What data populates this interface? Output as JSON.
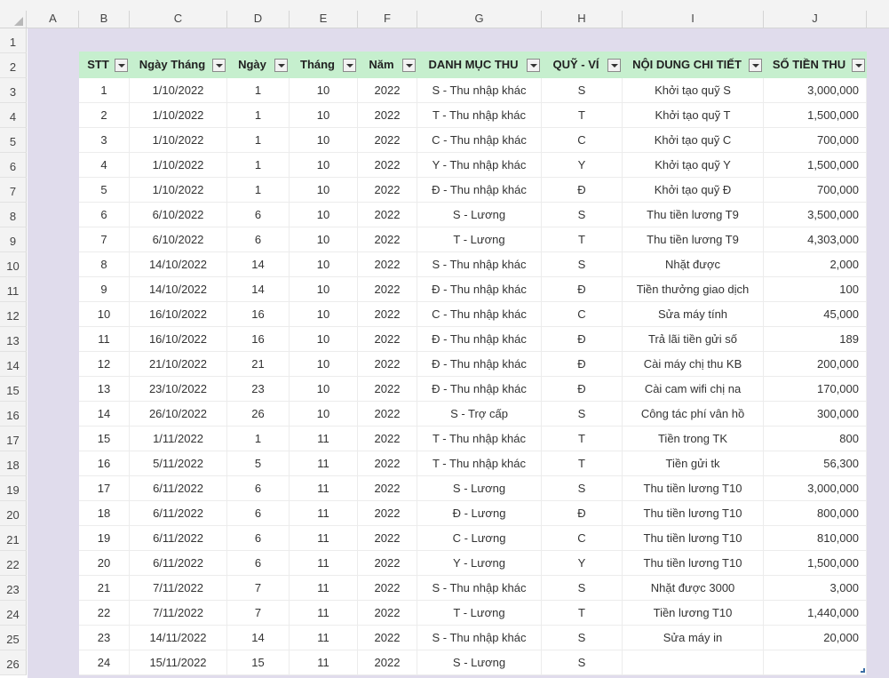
{
  "column_headers": [
    "A",
    "B",
    "C",
    "D",
    "E",
    "F",
    "G",
    "H",
    "I",
    "J"
  ],
  "row_headers": [
    "1",
    "2",
    "3",
    "4",
    "5",
    "6",
    "7",
    "8",
    "9",
    "10",
    "11",
    "12",
    "13",
    "14",
    "15",
    "16",
    "17",
    "18",
    "19",
    "20",
    "21",
    "22",
    "23",
    "24",
    "25",
    "26"
  ],
  "table": {
    "headers": [
      "STT",
      "Ngày Tháng",
      "Ngày",
      "Tháng",
      "Năm",
      "DANH MỤC THU",
      "QUỸ - VÍ",
      "NỘI DUNG CHI TIẾT",
      "SỐ TIỀN THU"
    ],
    "header_color": "#c6efce",
    "rows": [
      [
        "1",
        "1/10/2022",
        "1",
        "10",
        "2022",
        "S - Thu nhập khác",
        "S",
        "Khởi tạo quỹ S",
        "3,000,000"
      ],
      [
        "2",
        "1/10/2022",
        "1",
        "10",
        "2022",
        "T - Thu nhập khác",
        "T",
        "Khởi tạo quỹ T",
        "1,500,000"
      ],
      [
        "3",
        "1/10/2022",
        "1",
        "10",
        "2022",
        "C - Thu nhập khác",
        "C",
        "Khởi tạo quỹ C",
        "700,000"
      ],
      [
        "4",
        "1/10/2022",
        "1",
        "10",
        "2022",
        "Y - Thu nhập khác",
        "Y",
        "Khởi tạo quỹ Y",
        "1,500,000"
      ],
      [
        "5",
        "1/10/2022",
        "1",
        "10",
        "2022",
        "Đ - Thu nhập khác",
        "Đ",
        "Khởi tạo quỹ Đ",
        "700,000"
      ],
      [
        "6",
        "6/10/2022",
        "6",
        "10",
        "2022",
        "S - Lương",
        "S",
        "Thu tiền lương T9",
        "3,500,000"
      ],
      [
        "7",
        "6/10/2022",
        "6",
        "10",
        "2022",
        "T - Lương",
        "T",
        "Thu tiền lương T9",
        "4,303,000"
      ],
      [
        "8",
        "14/10/2022",
        "14",
        "10",
        "2022",
        "S - Thu nhập khác",
        "S",
        "Nhặt được",
        "2,000"
      ],
      [
        "9",
        "14/10/2022",
        "14",
        "10",
        "2022",
        "Đ - Thu nhập khác",
        "Đ",
        "Tiền thưởng giao dịch",
        "100"
      ],
      [
        "10",
        "16/10/2022",
        "16",
        "10",
        "2022",
        "C - Thu nhập khác",
        "C",
        "Sửa máy tính",
        "45,000"
      ],
      [
        "11",
        "16/10/2022",
        "16",
        "10",
        "2022",
        "Đ - Thu nhập khác",
        "Đ",
        "Trả lãi tiền gửi số",
        "189"
      ],
      [
        "12",
        "21/10/2022",
        "21",
        "10",
        "2022",
        "Đ - Thu nhập khác",
        "Đ",
        "Cài máy chị thu KB",
        "200,000"
      ],
      [
        "13",
        "23/10/2022",
        "23",
        "10",
        "2022",
        "Đ - Thu nhập khác",
        "Đ",
        "Cài cam wifi chị na",
        "170,000"
      ],
      [
        "14",
        "26/10/2022",
        "26",
        "10",
        "2022",
        "S - Trợ cấp",
        "S",
        "Công tác phí vân hồ",
        "300,000"
      ],
      [
        "15",
        "1/11/2022",
        "1",
        "11",
        "2022",
        "T - Thu nhập khác",
        "T",
        "Tiền trong TK",
        "800"
      ],
      [
        "16",
        "5/11/2022",
        "5",
        "11",
        "2022",
        "T - Thu nhập khác",
        "T",
        "Tiền gửi tk",
        "56,300"
      ],
      [
        "17",
        "6/11/2022",
        "6",
        "11",
        "2022",
        "S - Lương",
        "S",
        "Thu tiền lương T10",
        "3,000,000"
      ],
      [
        "18",
        "6/11/2022",
        "6",
        "11",
        "2022",
        "Đ - Lương",
        "Đ",
        "Thu tiền lương T10",
        "800,000"
      ],
      [
        "19",
        "6/11/2022",
        "6",
        "11",
        "2022",
        "C - Lương",
        "C",
        "Thu tiền lương T10",
        "810,000"
      ],
      [
        "20",
        "6/11/2022",
        "6",
        "11",
        "2022",
        "Y - Lương",
        "Y",
        "Thu tiền lương T10",
        "1,500,000"
      ],
      [
        "21",
        "7/11/2022",
        "7",
        "11",
        "2022",
        "S - Thu nhập khác",
        "S",
        "Nhặt được 3000",
        "3,000"
      ],
      [
        "22",
        "7/11/2022",
        "7",
        "11",
        "2022",
        "T - Lương",
        "T",
        "Tiền lương T10",
        "1,440,000"
      ],
      [
        "23",
        "14/11/2022",
        "14",
        "11",
        "2022",
        "S - Thu nhập khác",
        "S",
        "Sửa máy in",
        "20,000"
      ],
      [
        "24",
        "15/11/2022",
        "15",
        "11",
        "2022",
        "S - Lương",
        "S",
        "",
        ""
      ]
    ]
  }
}
